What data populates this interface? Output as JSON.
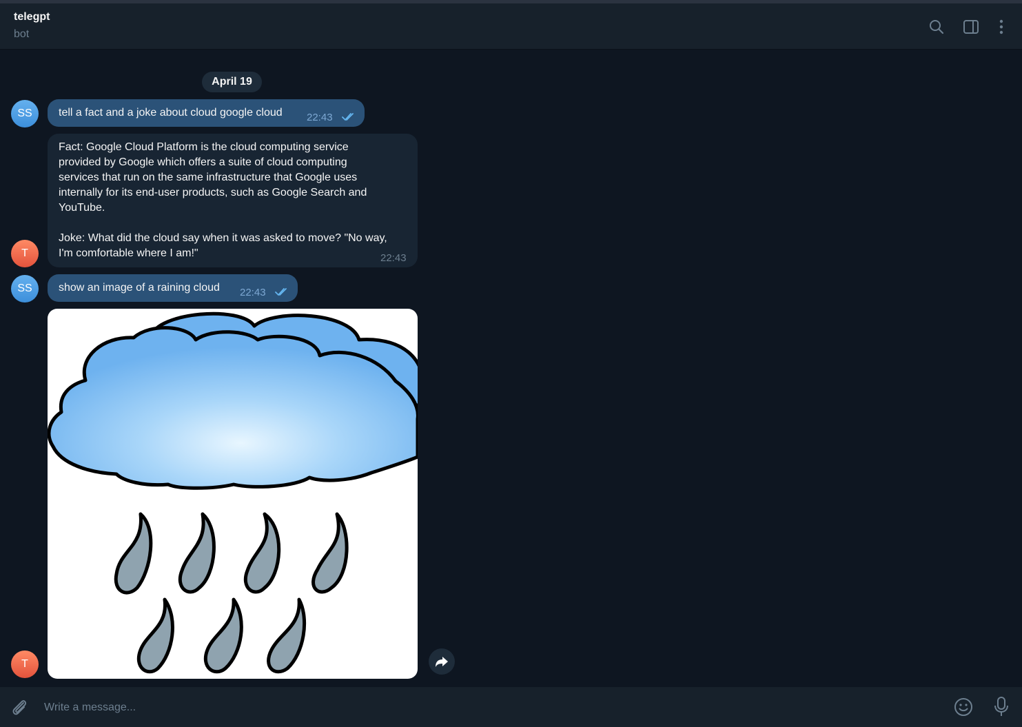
{
  "header": {
    "title": "telegpt",
    "status": "bot",
    "icons": [
      "search-icon",
      "sidebar-toggle-icon",
      "more-vertical-icon"
    ]
  },
  "date_separator": "April 19",
  "messages": [
    {
      "sender_avatar": "SS",
      "direction": "outgoing",
      "text": "tell a fact and a joke about cloud google cloud",
      "time": "22:43",
      "read": true
    },
    {
      "sender_avatar": "T",
      "direction": "incoming",
      "text": "Fact: Google Cloud Platform is the cloud computing service\nprovided by Google which offers a suite of cloud computing\nservices that run on the same infrastructure that Google uses\ninternally for its end-user products, such as Google Search and\nYouTube.\n\nJoke: What did the cloud say when it was asked to move? \"No way,\nI'm comfortable where I am!\"",
      "time": "22:43"
    },
    {
      "sender_avatar": "SS",
      "direction": "outgoing",
      "text": "show an image of a raining cloud",
      "time": "22:43",
      "read": true
    },
    {
      "sender_avatar": "T",
      "direction": "incoming",
      "image": "raining-cloud-illustration"
    }
  ],
  "composer": {
    "placeholder": "Write a message...",
    "icons": [
      "attach-icon",
      "emoji-icon",
      "microphone-icon"
    ]
  },
  "colors": {
    "background": "#0e1621",
    "header": "#17212b",
    "outgoing_bubble": "#2b5278",
    "incoming_bubble": "#182533",
    "accent": "#64b5ef"
  }
}
